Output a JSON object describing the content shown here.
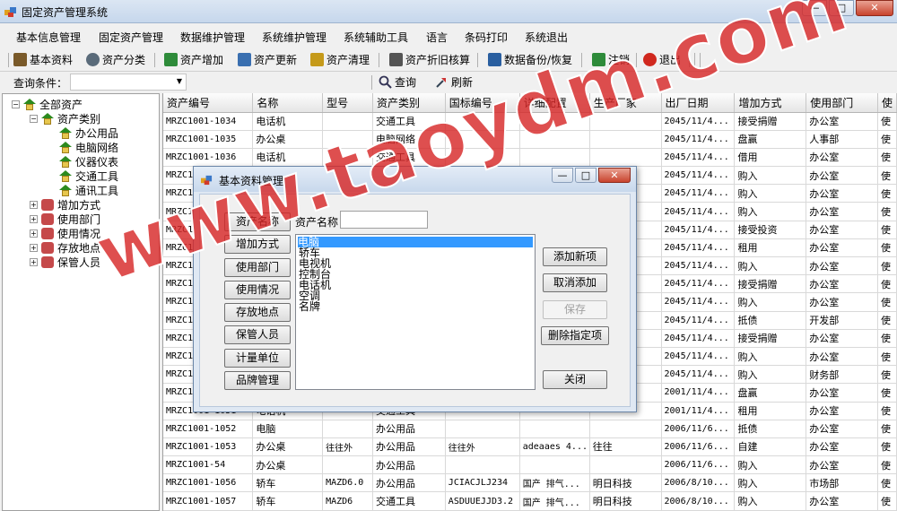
{
  "window": {
    "title": "固定资产管理系统",
    "min": "—",
    "max": "□",
    "close": "✕"
  },
  "menu": [
    "基本信息管理",
    "固定资产管理",
    "数据维护管理",
    "系统维护管理",
    "系统辅助工具",
    "语言",
    "条码打印",
    "系统退出"
  ],
  "toolbar": {
    "items": [
      {
        "label": "基本资料",
        "icon": "pencil-icon",
        "color": "#7a5a2a"
      },
      {
        "label": "资产分类",
        "icon": "gear-icon",
        "color": "#5a6b7a"
      },
      {
        "label": "资产增加",
        "icon": "add-icon",
        "color": "#2e8b3a"
      },
      {
        "label": "资产更新",
        "icon": "refresh-icon",
        "color": "#3a6fb0"
      },
      {
        "label": "资产清理",
        "icon": "clean-icon",
        "color": "#c59a1a"
      },
      {
        "label": "资产折旧核算",
        "icon": "calc-icon",
        "color": "#555555"
      },
      {
        "label": "数据备份/恢复",
        "icon": "database-icon",
        "color": "#2a5fa0"
      },
      {
        "label": "注销",
        "icon": "logout-icon",
        "color": "#2e8b3a"
      },
      {
        "label": "退出",
        "icon": "exit-icon",
        "color": "#d0281e"
      }
    ]
  },
  "query": {
    "label": "查询条件：",
    "search_label": "查询",
    "refresh_label": "刷新"
  },
  "tree": {
    "root": "全部资产",
    "category": "资产类别",
    "category_children": [
      "办公用品",
      "电脑网络",
      "仪器仪表",
      "交通工具",
      "通讯工具"
    ],
    "others": [
      "增加方式",
      "使用部门",
      "使用情况",
      "存放地点",
      "保管人员"
    ]
  },
  "grid": {
    "columns": [
      "资产编号",
      "名称",
      "型号",
      "资产类别",
      "国标编号",
      "详细配置",
      "生产厂家",
      "出厂日期",
      "增加方式",
      "使用部门",
      "使"
    ],
    "rows": [
      [
        "MRZC1001-1034",
        "电话机",
        "",
        "交通工具",
        "",
        "",
        "",
        "2045/11/4...",
        "接受捐赠",
        "办公室",
        "使"
      ],
      [
        "MRZC1001-1035",
        "办公桌",
        "",
        "电脑网络",
        "",
        "",
        "",
        "2045/11/4...",
        "盘赢",
        "人事部",
        "使"
      ],
      [
        "MRZC1001-1036",
        "电话机",
        "",
        "交通工具",
        "",
        "",
        "",
        "2045/11/4...",
        "借用",
        "办公室",
        "使"
      ],
      [
        "MRZC1",
        "",
        "",
        "",
        "",
        "",
        "",
        "2045/11/4...",
        "购入",
        "办公室",
        "使"
      ],
      [
        "MRZC1",
        "",
        "",
        "",
        "",
        "",
        "",
        "2045/11/4...",
        "购入",
        "办公室",
        "使"
      ],
      [
        "MRZC1",
        "",
        "",
        "",
        "",
        "",
        "",
        "2045/11/4...",
        "购入",
        "办公室",
        "使"
      ],
      [
        "MRZC1",
        "",
        "",
        "",
        "",
        "",
        "",
        "2045/11/4...",
        "接受投资",
        "办公室",
        "使"
      ],
      [
        "MRZC1",
        "",
        "",
        "",
        "",
        "",
        "",
        "2045/11/4...",
        "租用",
        "办公室",
        "使"
      ],
      [
        "MRZC1",
        "",
        "",
        "",
        "",
        "",
        "",
        "2045/11/4...",
        "购入",
        "办公室",
        "使"
      ],
      [
        "MRZC1",
        "",
        "",
        "",
        "",
        "",
        "",
        "2045/11/4...",
        "接受捐赠",
        "办公室",
        "使"
      ],
      [
        "MRZC1",
        "",
        "",
        "",
        "",
        "",
        "",
        "2045/11/4...",
        "购入",
        "办公室",
        "使"
      ],
      [
        "MRZC1",
        "",
        "",
        "",
        "",
        "",
        "",
        "2045/11/4...",
        "抵债",
        "开发部",
        "使"
      ],
      [
        "MRZC1",
        "",
        "",
        "",
        "",
        "",
        "",
        "2045/11/4...",
        "接受捐赠",
        "办公室",
        "使"
      ],
      [
        "MRZC1",
        "",
        "",
        "",
        "",
        "",
        "",
        "2045/11/4...",
        "购入",
        "办公室",
        "使"
      ],
      [
        "MRZC1",
        "",
        "",
        "",
        "",
        "",
        "",
        "2045/11/4...",
        "购入",
        "财务部",
        "使"
      ],
      [
        "MRZC1",
        "",
        "",
        "",
        "",
        "",
        "",
        "2001/11/4...",
        "盘赢",
        "办公室",
        "使"
      ],
      [
        "MRZC1001-1051",
        "电话机",
        "",
        "交通工具",
        "",
        "",
        "",
        "2001/11/4...",
        "租用",
        "办公室",
        "使"
      ],
      [
        "MRZC1001-1052",
        "电脑",
        "",
        "办公用品",
        "",
        "",
        "",
        "2006/11/6...",
        "抵债",
        "办公室",
        "使"
      ],
      [
        "MRZC1001-1053",
        "办公桌",
        "往往外",
        "办公用品",
        "往往外",
        "adeaaes 4...",
        "往往",
        "2006/11/6...",
        "自建",
        "办公室",
        "使"
      ],
      [
        "MRZC1001-54",
        "办公桌",
        "",
        "办公用品",
        "",
        "",
        "",
        "2006/11/6...",
        "购入",
        "办公室",
        "使"
      ],
      [
        "MRZC1001-1056",
        "轿车",
        "MAZD6.0",
        "办公用品",
        "JCIACJLJ234",
        "国产 排气...",
        "明日科技",
        "2006/8/10...",
        "购入",
        "市场部",
        "使"
      ],
      [
        "MRZC1001-1057",
        "轿车",
        "MAZD6",
        "交通工具",
        "ASDUUEJJD3.2",
        "国产 排气...",
        "明日科技",
        "2006/8/10...",
        "购入",
        "办公室",
        "使"
      ]
    ]
  },
  "dialog": {
    "title": "基本资料管理",
    "side_buttons": [
      "资产名称",
      "增加方式",
      "使用部门",
      "使用情况",
      "存放地点",
      "保管人员",
      "计量单位",
      "品牌管理"
    ],
    "field_label": "资产名称",
    "field_value": "",
    "list_items": [
      "电脑",
      "轿车",
      "电视机",
      "控制台",
      "电话机",
      "空调",
      "名牌"
    ],
    "selected_index": 0,
    "action_buttons": {
      "add": "添加新项",
      "cancel": "取消添加",
      "save": "保存",
      "delete": "删除指定项",
      "close": "关闭"
    }
  },
  "watermark": "www.taoydm.com"
}
